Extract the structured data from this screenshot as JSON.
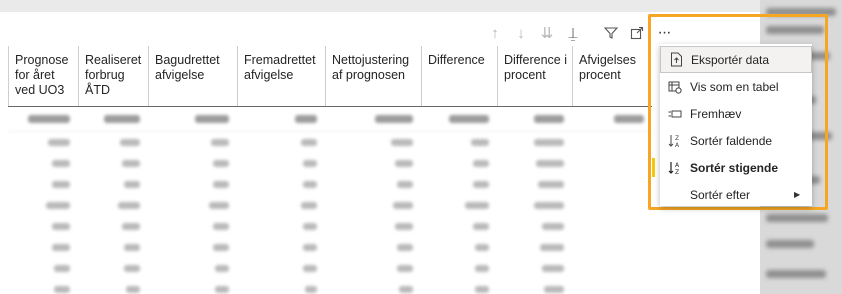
{
  "toolbar": {
    "icons": [
      "arrow-up-icon",
      "arrow-down-icon",
      "double-arrow-down-icon",
      "expand-hierarchy-icon",
      "filter-icon",
      "focus-mode-icon",
      "more-options-icon"
    ],
    "more_label": "···"
  },
  "table": {
    "headers": [
      "Prognose for året ved UO3",
      "Realiseret forbrug ÅTD",
      "Bagudrettet afvigelse",
      "Fremadrettet afvigelse",
      "Nettojustering af prognosen",
      "Difference",
      "Difference i procent",
      "Afvigelses procent"
    ],
    "rows_blurred": 9
  },
  "context_menu": {
    "items": [
      {
        "label": "Eksportér data",
        "icon": "export-data-icon"
      },
      {
        "label": "Vis som en tabel",
        "icon": "show-as-table-icon"
      },
      {
        "label": "Fremhæv",
        "icon": "spotlight-icon"
      },
      {
        "label": "Sortér faldende",
        "icon": "sort-descending-icon"
      },
      {
        "label": "Sortér stigende",
        "icon": "sort-ascending-icon"
      },
      {
        "label": "Sortér efter",
        "icon": "chevron-right-icon"
      }
    ]
  },
  "colors": {
    "highlight_border": "#f5a623",
    "active_marker": "#f2c811"
  }
}
